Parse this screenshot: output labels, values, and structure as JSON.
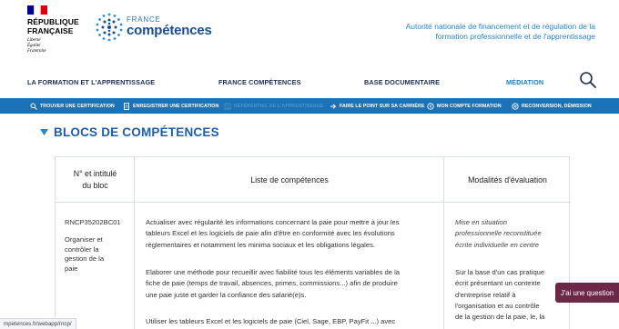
{
  "header": {
    "rf": {
      "name_lines": [
        "RÉPUBLIQUE",
        "FRANÇAISE"
      ],
      "motto_lines": [
        "Liberté",
        "Égalité",
        "Fraternité"
      ]
    },
    "brand": {
      "top": "FRANCE",
      "main": "compétences"
    },
    "authority_lines": [
      "Autorité nationale de financement et de régulation de la",
      "formation professionnelle et de l'apprentissage"
    ]
  },
  "nav": {
    "items": [
      {
        "label": "LA FORMATION ET L'APPRENTISSAGE",
        "active": false
      },
      {
        "label": "FRANCE COMPÉTENCES",
        "active": false
      },
      {
        "label": "BASE DOCUMENTAIRE",
        "active": false
      },
      {
        "label": "MÉDIATION",
        "active": true
      }
    ],
    "search_icon": "search-icon"
  },
  "subnav": {
    "items": [
      {
        "label": "TROUVER UNE CERTIFICATION",
        "icon": "search-icon"
      },
      {
        "label": "ENREGISTRER UNE CERTIFICATION",
        "icon": "document-icon"
      },
      {
        "label": "RÉFÉRENTIEL DE L'APPRENTISSAGE",
        "icon": "book-icon",
        "current": true
      },
      {
        "label": "FAIRE LE POINT SUR SA CARRIÈRE",
        "icon": "arrow-icon"
      },
      {
        "label": "MON COMPTE FORMATION",
        "icon": "circle-icon"
      },
      {
        "label": "RECONVERSION, DÉMISSION",
        "icon": "swap-icon"
      }
    ],
    "bg_color": "#1b72b6"
  },
  "section": {
    "title": "BLOCS DE COMPÉTENCES"
  },
  "table": {
    "headers": {
      "bloc_lines": [
        "N° et intitulé",
        "du bloc"
      ],
      "competences": "Liste de compétences",
      "evaluation": "Modalités d'évaluation"
    },
    "row": {
      "code": "RNCP35202BC01",
      "name_lines": [
        "Organiser et",
        "contrôler la",
        "gestion de la",
        "paie"
      ],
      "competences": [
        [
          "Actualiser avec régularité les informations concernant la paie pour mettre à jour les",
          "tableurs Excel et les logiciels de paie afin d'être en conformité avec les évolutions",
          "règlementaires et notamment les minima sociaux et les obligations légales."
        ],
        [
          "Elaborer une méthode pour recueillir avec fiabilité tous les éléments variables de la",
          "fiche de paie (temps de travail, absences, primes, commissions...) afin de produire",
          "une paie juste et garder la confiance des salarié(e)s."
        ],
        [
          "Utiliser les tableurs Excel et les logiciels de paie (Ciel, Sage, EBP, PayFit ...) avec"
        ]
      ],
      "evaluation_italic_lines": [
        "Mise en situation",
        "professionnelle reconstituée",
        "écrite individuelle en centre"
      ],
      "evaluation_lines": [
        "Sur la base d'un cas pratique",
        "écrit présentant un contexte",
        "d'entreprise relatif à",
        "l'organisation et au contrôle",
        "de la gestion de la paie, le, la"
      ]
    }
  },
  "floating": {
    "question": "J'ai une question"
  },
  "status_url": "mpetences.fr/webapp/rncp/"
}
